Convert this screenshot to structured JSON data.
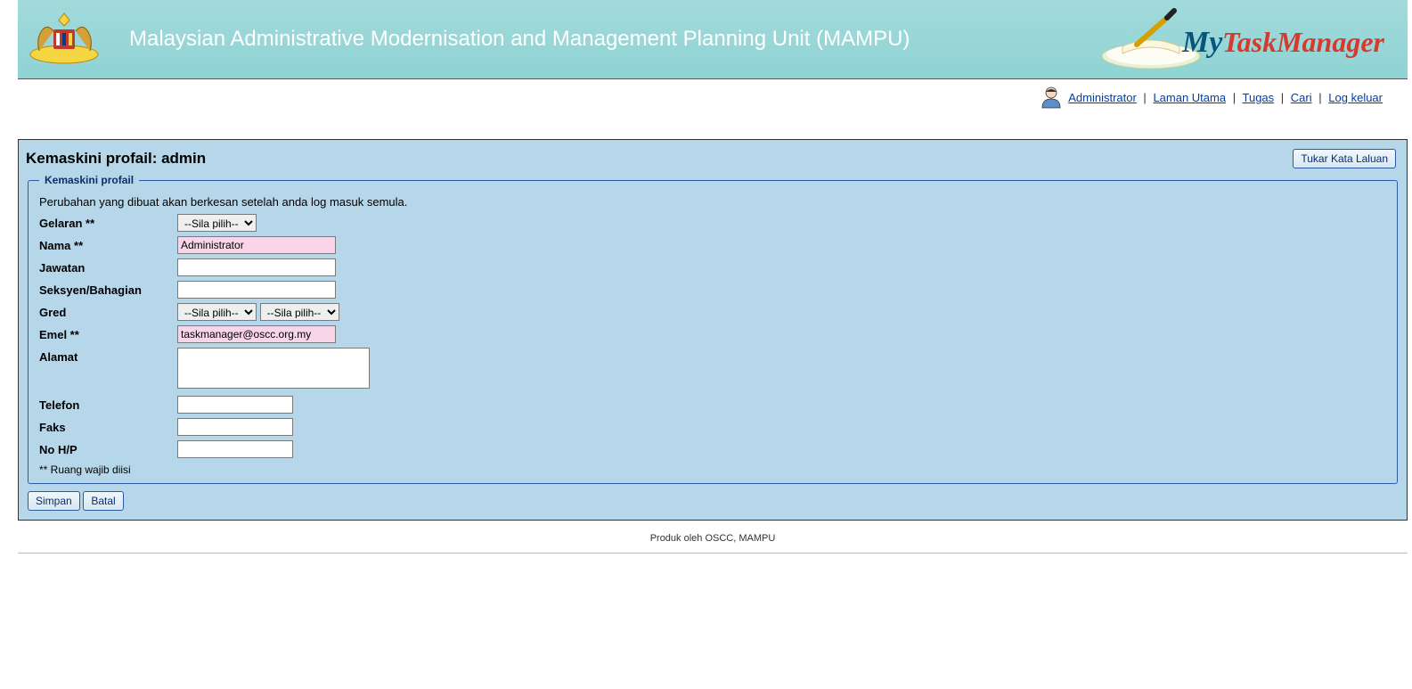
{
  "header": {
    "title": "Malaysian Administrative Modernisation and Management Planning Unit (MAMPU)",
    "app_logo_my": "My",
    "app_logo_task": "TaskManager"
  },
  "topnav": {
    "user": "Administrator",
    "links": {
      "home": "Laman Utama",
      "tasks": "Tugas",
      "search": "Cari",
      "logout": "Log keluar"
    }
  },
  "page": {
    "title": "Kemaskini profail: admin",
    "change_password_btn": "Tukar Kata Laluan"
  },
  "form": {
    "legend": "Kemaskini profail",
    "info": "Perubahan yang dibuat akan berkesan setelah anda log masuk semula.",
    "labels": {
      "gelaran": "Gelaran **",
      "nama": "Nama **",
      "jawatan": "Jawatan",
      "seksyen": "Seksyen/Bahagian",
      "gred": "Gred",
      "emel": "Emel **",
      "alamat": "Alamat",
      "telefon": "Telefon",
      "faks": "Faks",
      "nohp": "No H/P"
    },
    "values": {
      "gelaran_placeholder": "--Sila pilih--",
      "nama": "Administrator",
      "jawatan": "",
      "seksyen": "",
      "gred1_placeholder": "--Sila pilih--",
      "gred2_placeholder": "--Sila pilih--",
      "emel": "taskmanager@oscc.org.my",
      "alamat": "",
      "telefon": "",
      "faks": "",
      "nohp": ""
    },
    "required_note": "** Ruang wajib diisi",
    "save_btn": "Simpan",
    "cancel_btn": "Batal"
  },
  "footer": {
    "text": "Produk oleh OSCC, MAMPU"
  }
}
